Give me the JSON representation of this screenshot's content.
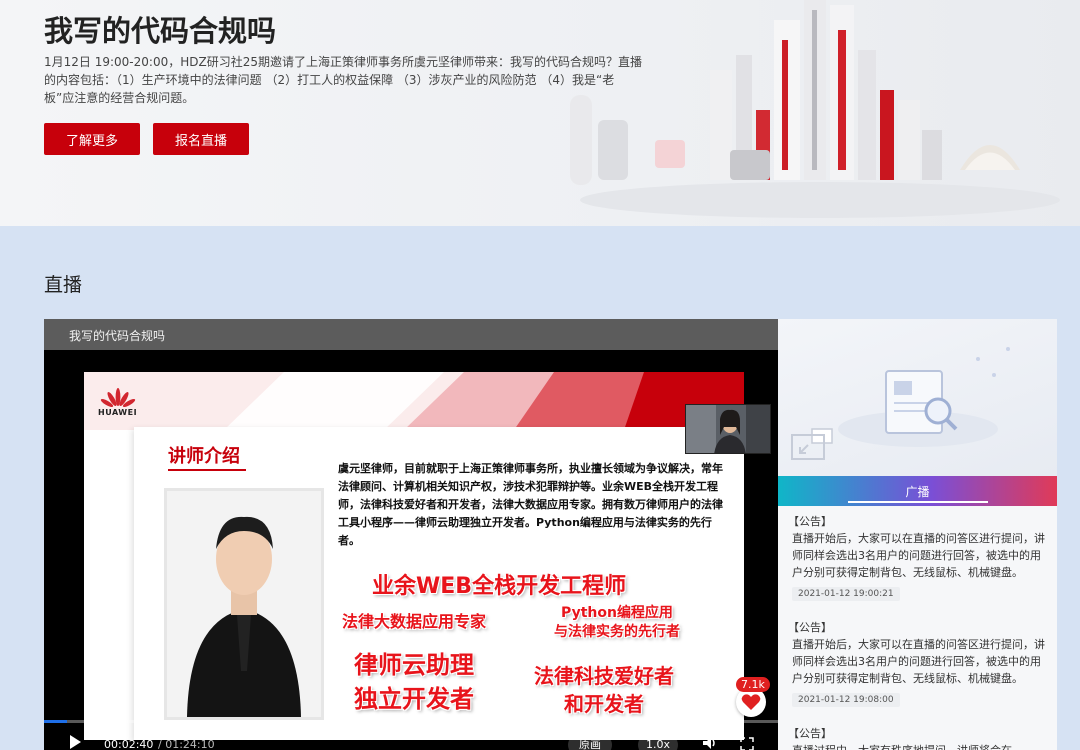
{
  "hero": {
    "title": "我写的代码合规吗",
    "description": "1月12日 19:00-20:00，HDZ研习社25期邀请了上海正策律师事务所虞元坚律师带来：我写的代码合规吗？直播的内容包括：（1）生产环境中的法律问题 （2）打工人的权益保障 （3）涉灰产业的风险防范 （4）我是“老板”应注意的经营合规问题。",
    "learn_more": "了解更多",
    "signup": "报名直播"
  },
  "section": {
    "title": "直播"
  },
  "player": {
    "title": "我写的代码合规吗",
    "slide": {
      "logo_text": "HUAWEI",
      "heading": "讲师介绍",
      "bio": "虞元坚律师，目前就职于上海正策律师事务所，执业擅长领域为争议解决，常年法律顾问、计算机相关知识产权，涉技术犯罪辩护等。业余WEB全栈开发工程师，法律科技爱好者和开发者，法律大数据应用专家。拥有数万律师用户的法律工具小程序——律师云助理独立开发者。Python编程应用与法律实务的先行者。",
      "tag1": "业余WEB全栈开发工程师",
      "tag2": "法律大数据应用专家",
      "tag3": "Python编程应用\n与法律实务的先行者",
      "tag4": "律师云助理\n独立开发者",
      "tag5": "法律科技爱好者\n和开发者"
    },
    "likes": "7.1k",
    "time_current": "00:02:40",
    "time_total": " / 01:24:10",
    "progress": 0.032,
    "quality": "原画",
    "speed": "1.0x"
  },
  "side": {
    "tab": "广播",
    "notices": [
      {
        "tag": "【公告】",
        "body": "直播开始后，大家可以在直播的问答区进行提问，讲师同样会选出3名用户的问题进行回答，被选中的用户分别可获得定制背包、无线鼠标、机械键盘。",
        "time": "2021-01-12 19:00:21"
      },
      {
        "tag": "【公告】",
        "body": "直播开始后，大家可以在直播的问答区进行提问，讲师同样会选出3名用户的问题进行回答，被选中的用户分别可获得定制背包、无线鼠标、机械键盘。",
        "time": "2021-01-12 19:08:00"
      },
      {
        "tag": "【公告】",
        "body": "直播过程中，大家有秩序地提问，讲师将会在",
        "time": ""
      }
    ]
  },
  "colors": {
    "brand_red": "#c7000b",
    "page_bg": "#d6e2f3"
  }
}
